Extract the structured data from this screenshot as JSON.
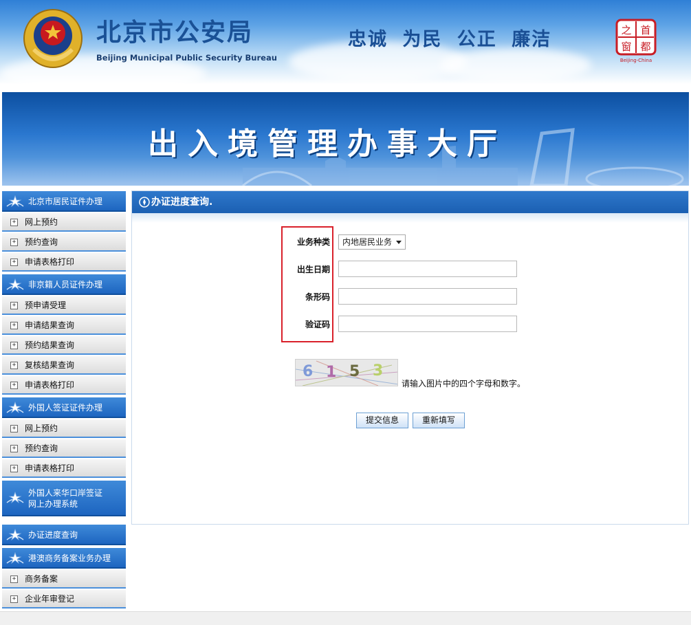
{
  "header": {
    "title": "北京市公安局",
    "subtitle": "Beijing Municipal Public Security Bureau",
    "slogan": "忠诚 为民 公正 廉洁",
    "capital_logo": {
      "chars": [
        "之",
        "首",
        "窗",
        "都"
      ],
      "caption": "Beijing-China"
    }
  },
  "banner": {
    "title": "出入境管理办事大厅"
  },
  "sidebar": {
    "sections": [
      {
        "label": "北京市居民证件办理",
        "items": [
          "网上预约",
          "预约查询",
          "申请表格打印"
        ]
      },
      {
        "label": "非京籍人员证件办理",
        "items": [
          "预申请受理",
          "申请结果查询",
          "预约结果查询",
          "复核结果查询",
          "申请表格打印"
        ]
      },
      {
        "label": "外国人签证证件办理",
        "items": [
          "网上预约",
          "预约查询",
          "申请表格打印"
        ]
      },
      {
        "label_line1": "外国人来华口岸签证",
        "label_line2": "网上办理系统",
        "items": []
      },
      {
        "label": "办证进度查询",
        "items": []
      },
      {
        "label": "港澳商务备案业务办理",
        "items": [
          "商务备案",
          "企业年审登记"
        ]
      }
    ]
  },
  "main": {
    "title": "办证进度查询.",
    "form": {
      "business_type_label": "业务种类",
      "business_type_value": "内地居民业务",
      "birth_date_label": "出生日期",
      "birth_date_value": "",
      "barcode_label": "条形码",
      "barcode_value": "",
      "verify_label": "验证码",
      "verify_value": ""
    },
    "captcha": {
      "text": "6153",
      "hint": "请输入图片中的四个字母和数字。"
    },
    "buttons": {
      "submit": "提交信息",
      "reset": "重新填写"
    }
  },
  "colors": {
    "brand_blue": "#1d65c0",
    "highlight_red": "#d9202a"
  }
}
